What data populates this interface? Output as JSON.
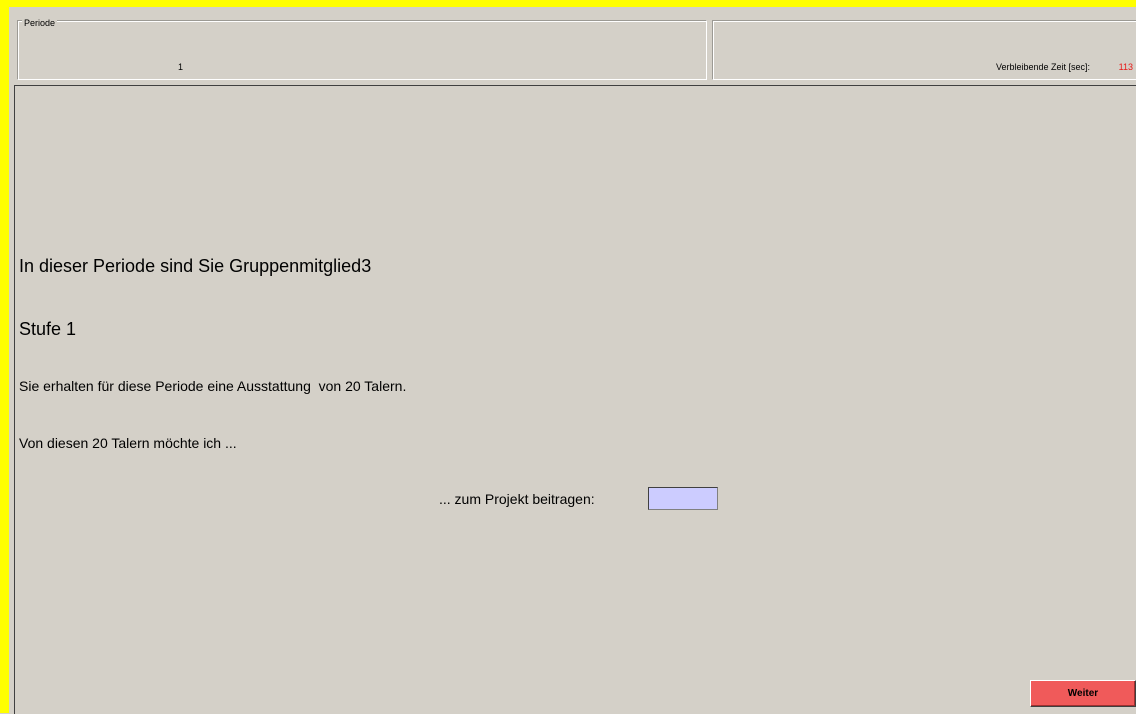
{
  "header": {
    "period_legend": "Periode",
    "period_value": "1",
    "time_label": "Verbleibende Zeit [sec]:",
    "time_value": "113",
    "time_value_color": "#e81818"
  },
  "main": {
    "member_text": "In dieser Periode sind Sie Gruppenmitglied3",
    "stage_text": "Stufe 1",
    "endowment_text": "Sie erhalten für diese Periode eine Ausstattung  von 20 Talern.",
    "from_text": "Von diesen 20 Talern möchte ich ...",
    "contribution_label": "... zum Projekt beitragen:",
    "contribution_value": "",
    "weiter_label": "Weiter"
  },
  "colors": {
    "frame": "#ffff00",
    "background": "#d4d0c8",
    "input_background": "#ccccff",
    "button_background": "#f05a5a"
  }
}
